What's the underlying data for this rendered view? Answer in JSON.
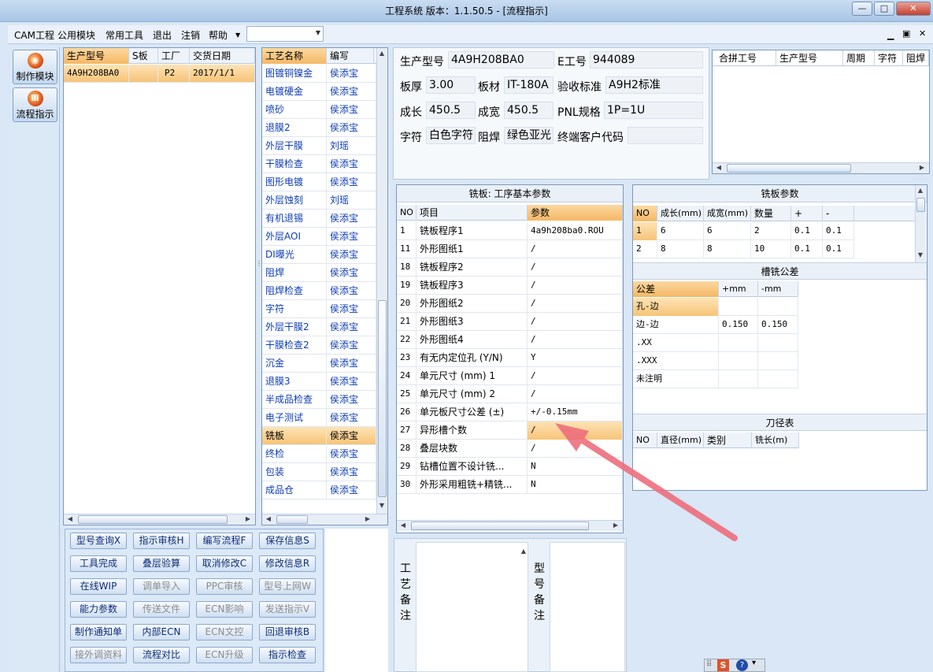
{
  "window": {
    "title": "工程系统   版本：1.1.50.5 - [流程指示]"
  },
  "menu": {
    "items": [
      "CAM工程",
      "公用模块",
      "常用工具",
      "退出",
      "注销",
      "帮助"
    ],
    "combo_value": ""
  },
  "nav": {
    "buttons": [
      "制作模块",
      "流程指示"
    ]
  },
  "model_list": {
    "headers": [
      "生产型号",
      "S板",
      "工厂",
      "交货日期"
    ],
    "rows": [
      [
        "4A9H208BA0",
        "",
        "P2",
        "2017/1/1"
      ]
    ]
  },
  "process_list": {
    "headers": [
      "工艺名称",
      "编写"
    ],
    "rows": [
      [
        "图镀铜镍金",
        "侯添宝"
      ],
      [
        "电镀硬金",
        "侯添宝"
      ],
      [
        "喷砂",
        "侯添宝"
      ],
      [
        "退膜2",
        "侯添宝"
      ],
      [
        "外层干膜",
        "刘瑶"
      ],
      [
        "干膜检查",
        "侯添宝"
      ],
      [
        "图形电镀",
        "侯添宝"
      ],
      [
        "外层蚀刻",
        "刘瑶"
      ],
      [
        "有机退锡",
        "侯添宝"
      ],
      [
        "外层AOI",
        "侯添宝"
      ],
      [
        "DI曝光",
        "侯添宝"
      ],
      [
        "阻焊",
        "侯添宝"
      ],
      [
        "阻焊检查",
        "侯添宝"
      ],
      [
        "字符",
        "侯添宝"
      ],
      [
        "外层干膜2",
        "侯添宝"
      ],
      [
        "干膜检查2",
        "侯添宝"
      ],
      [
        "沉金",
        "侯添宝"
      ],
      [
        "退膜3",
        "侯添宝"
      ],
      [
        "半成品检查",
        "侯添宝"
      ],
      [
        "电子测试",
        "侯添宝"
      ],
      [
        "铣板",
        "侯添宝"
      ],
      [
        "终检",
        "侯添宝"
      ],
      [
        "包装",
        "侯添宝"
      ],
      [
        "成品仓",
        "侯添宝"
      ]
    ],
    "selected_index": 20
  },
  "buttons": [
    [
      "型号查询X",
      "指示审核H",
      "编写流程F",
      "保存信息S"
    ],
    [
      "工具完成",
      "叠层验算",
      "取消修改C",
      "修改信息R"
    ],
    [
      "在线WIP",
      "调单导入",
      "PPC审核",
      "型号上网W"
    ],
    [
      "能力参数",
      "传送文件",
      "ECN影响",
      "发送指示V"
    ],
    [
      "制作通知单",
      "内部ECN",
      "ECN文控",
      "回退审核B"
    ],
    [
      "接外调资料",
      "流程对比",
      "ECN升级",
      "指示检查"
    ]
  ],
  "buttons_disabled": [
    [
      false,
      false,
      false,
      false
    ],
    [
      false,
      false,
      false,
      false
    ],
    [
      false,
      true,
      true,
      true
    ],
    [
      false,
      true,
      true,
      true
    ],
    [
      false,
      false,
      true,
      false
    ],
    [
      true,
      false,
      true,
      false
    ]
  ],
  "info": {
    "model_label": "生产型号",
    "model": "4A9H208BA0",
    "eng_label": "E工号",
    "eng": "944089",
    "thick_label": "板厚",
    "thick": "3.00",
    "mat_label": "板材",
    "mat": "IT-180A",
    "accept_label": "验收标准",
    "accept": "A9H2标准",
    "len_label": "成长",
    "len": "450.5",
    "wid_label": "成宽",
    "wid": "450.5",
    "pnl_label": "PNL规格",
    "pnl": "1P=1U",
    "char_label": "字符",
    "char": "白色字符",
    "mask_label": "阻焊",
    "mask": "绿色亚光",
    "cust_label": "终端客户代码",
    "cust": ""
  },
  "merge_table": {
    "headers": [
      "合拼工号",
      "生产型号",
      "周期",
      "字符",
      "阻焊"
    ]
  },
  "params": {
    "title": "铣板: 工序基本参数",
    "headers": [
      "NO",
      "项目",
      "参数"
    ],
    "rows": [
      [
        "1",
        "铣板程序1",
        "4a9h208ba0.ROU"
      ],
      [
        "11",
        "外形图纸1",
        "/"
      ],
      [
        "18",
        "铣板程序2",
        "/"
      ],
      [
        "19",
        "铣板程序3",
        "/"
      ],
      [
        "20",
        "外形图纸2",
        "/"
      ],
      [
        "21",
        "外形图纸3",
        "/"
      ],
      [
        "22",
        "外形图纸4",
        "/"
      ],
      [
        "23",
        "有无内定位孔 (Y/N)",
        "Y"
      ],
      [
        "24",
        "单元尺寸 (mm) 1",
        "/"
      ],
      [
        "25",
        "单元尺寸 (mm) 2",
        "/"
      ],
      [
        "26",
        "单元板尺寸公差 (±)",
        "+/-0.15mm"
      ],
      [
        "27",
        "异形槽个数",
        "/"
      ],
      [
        "28",
        "叠层块数",
        "/"
      ],
      [
        "29",
        "钻槽位置不设计铣...",
        "N"
      ],
      [
        "30",
        "外形采用粗铣+精铣...",
        "N"
      ]
    ],
    "selected_index": 11
  },
  "mill_params": {
    "title": "铣板参数",
    "headers": [
      "NO",
      "成长(mm)",
      "成宽(mm)",
      "数量",
      "+",
      "-"
    ],
    "rows": [
      [
        "1",
        "6",
        "6",
        "2",
        "0.1",
        "0.1"
      ],
      [
        "2",
        "8",
        "8",
        "10",
        "0.1",
        "0.1"
      ]
    ]
  },
  "tolerance": {
    "title": "槽铣公差",
    "headers": [
      "公差",
      "+mm",
      "-mm"
    ],
    "rows": [
      [
        "孔-边",
        "",
        ""
      ],
      [
        "边-边",
        "0.150",
        "0.150"
      ],
      [
        ".XX",
        "",
        ""
      ],
      [
        ".XXX",
        "",
        ""
      ],
      [
        "未注明",
        "",
        ""
      ]
    ]
  },
  "tools": {
    "title": "刀径表",
    "headers": [
      "NO",
      "直径(mm)",
      "类别",
      "铣长(m)"
    ]
  },
  "remarks": {
    "process_label": "工艺备注",
    "model_label": "型号备注"
  },
  "colors": {
    "accent": "#f5b765",
    "link": "#0d3cb4",
    "annotation_arrow": "#ee6f7d"
  }
}
